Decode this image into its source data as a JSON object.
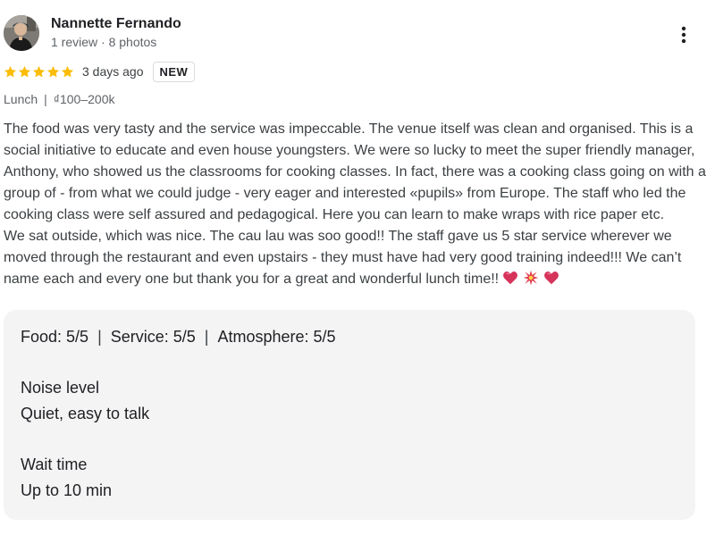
{
  "reviewer": {
    "name": "Nannette Fernando",
    "meta": "1 review · 8 photos"
  },
  "rating": {
    "stars": 5,
    "star_color": "#fbbc04",
    "time_ago": "3 days ago",
    "badge": "NEW"
  },
  "meal": {
    "type": "Lunch",
    "separator": "|",
    "price": "₫100–200k"
  },
  "review": {
    "paragraphs": [
      "The food was very tasty and the service was impeccable. The venue itself was clean and organised. This is a social initiative to educate and even house youngsters. We were so lucky to meet the super friendly manager, Anthony, who showed us the classrooms for cooking classes. In fact, there was a cooking class going on with a group of - from what we could judge - very eager and interested «pupils» from Europe. The staff who led the cooking class were self assured and pedagogical. Here you can learn to make wraps with rice paper etc.",
      "We sat outside, which was nice. The cau lau was soo good!! The staff gave us 5 star service wherever we moved through the restaurant and even upstairs - they must have had very good training indeed!!! We can’t name each and every one but thank you for a great and wonderful lunch time!!"
    ],
    "emojis": [
      "heart-icon",
      "sparkle-icon",
      "heart-icon"
    ]
  },
  "details": {
    "food": "Food: 5/5",
    "service": "Service: 5/5",
    "atmosphere": "Atmosphere: 5/5",
    "separator": "|",
    "noise_label": "Noise level",
    "noise_value": "Quiet, easy to talk",
    "wait_label": "Wait time",
    "wait_value": "Up to 10 min"
  }
}
